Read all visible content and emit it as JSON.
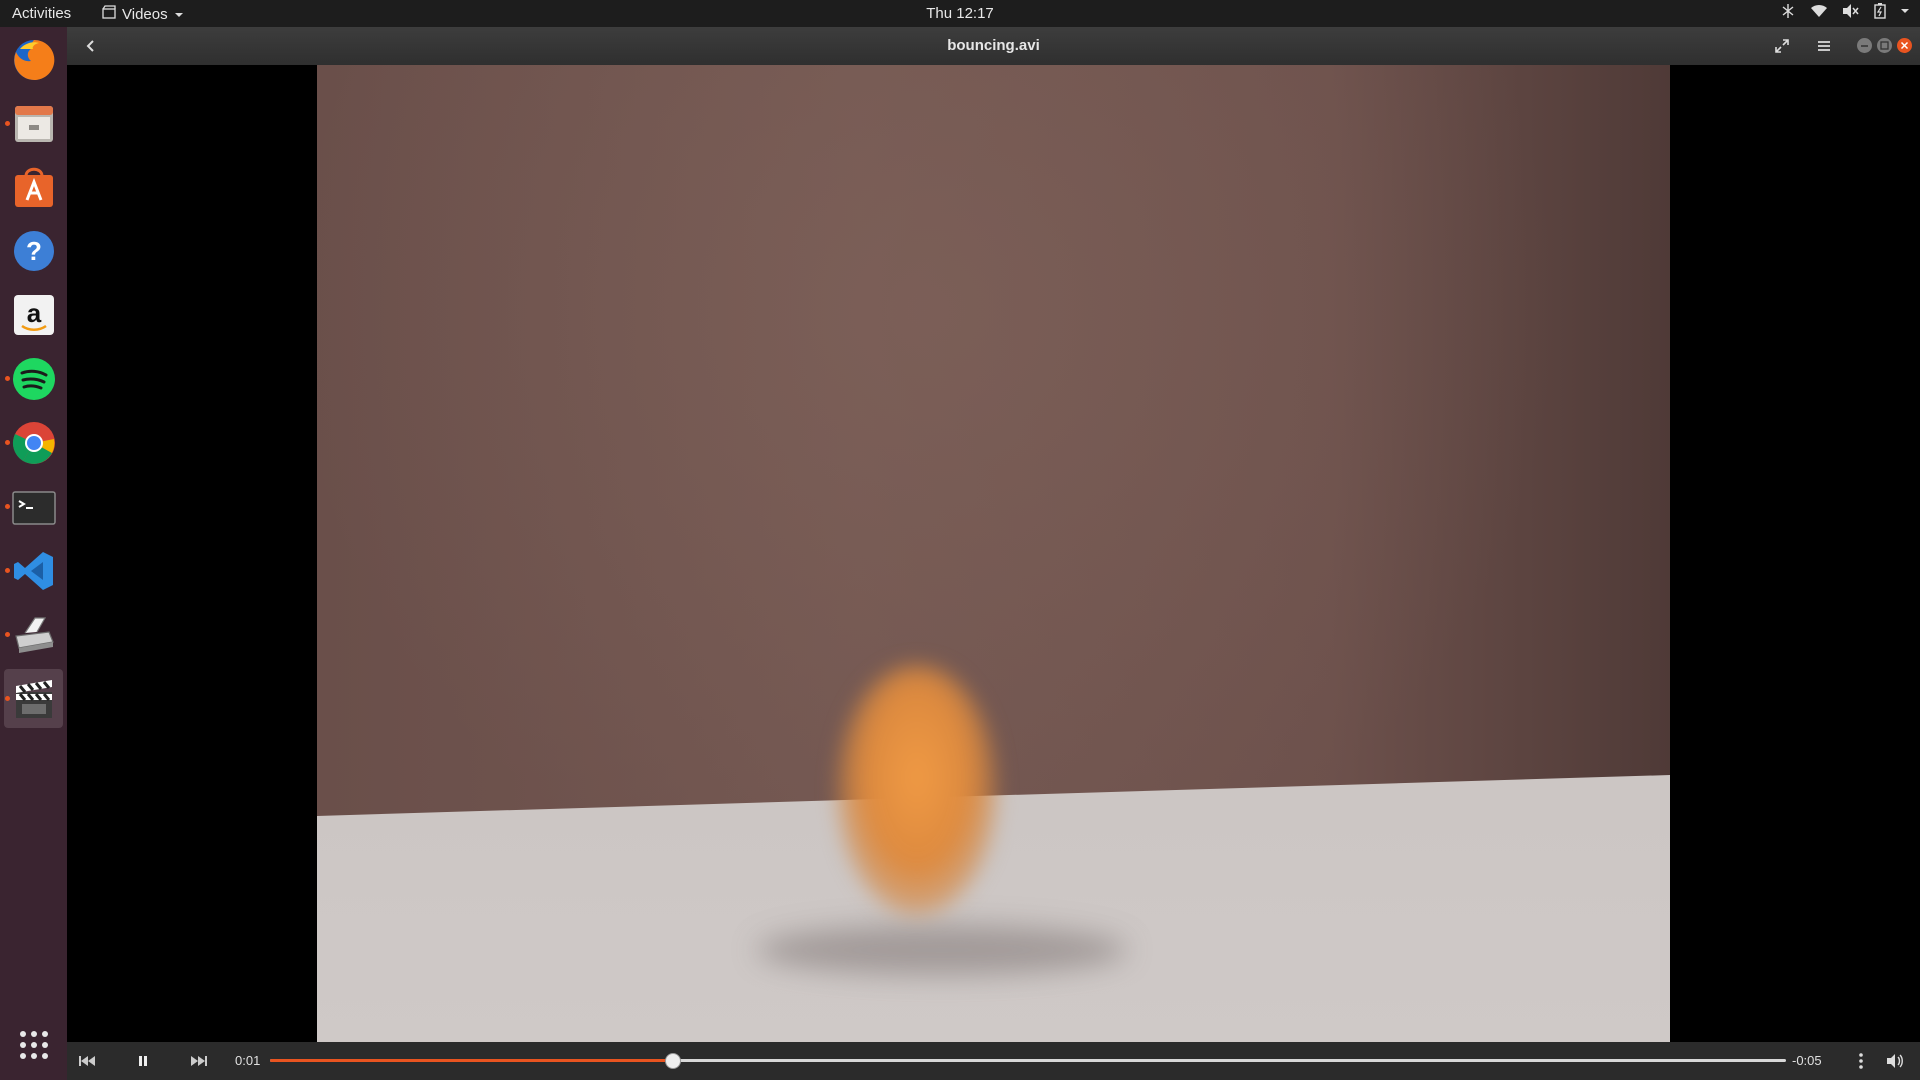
{
  "topbar": {
    "activities": "Activities",
    "app_menu": "Videos",
    "clock": "Thu 12:17"
  },
  "dock": {
    "items": [
      {
        "name": "firefox",
        "running": false
      },
      {
        "name": "files",
        "running": true
      },
      {
        "name": "software",
        "running": false
      },
      {
        "name": "help",
        "running": false
      },
      {
        "name": "amazon",
        "running": false
      },
      {
        "name": "spotify",
        "running": true
      },
      {
        "name": "chrome",
        "running": true
      },
      {
        "name": "terminal",
        "running": true
      },
      {
        "name": "vscode",
        "running": true
      },
      {
        "name": "scanner",
        "running": true
      },
      {
        "name": "videos",
        "running": true,
        "active": true
      }
    ]
  },
  "window": {
    "title": "bouncing.avi"
  },
  "player": {
    "elapsed": "0:01",
    "remaining": "-0:05",
    "progress": 0.265,
    "state": "playing"
  },
  "colors": {
    "accent": "#e95420",
    "dock_bg": "#3a2430",
    "topbar_bg": "#1d1d1d"
  }
}
